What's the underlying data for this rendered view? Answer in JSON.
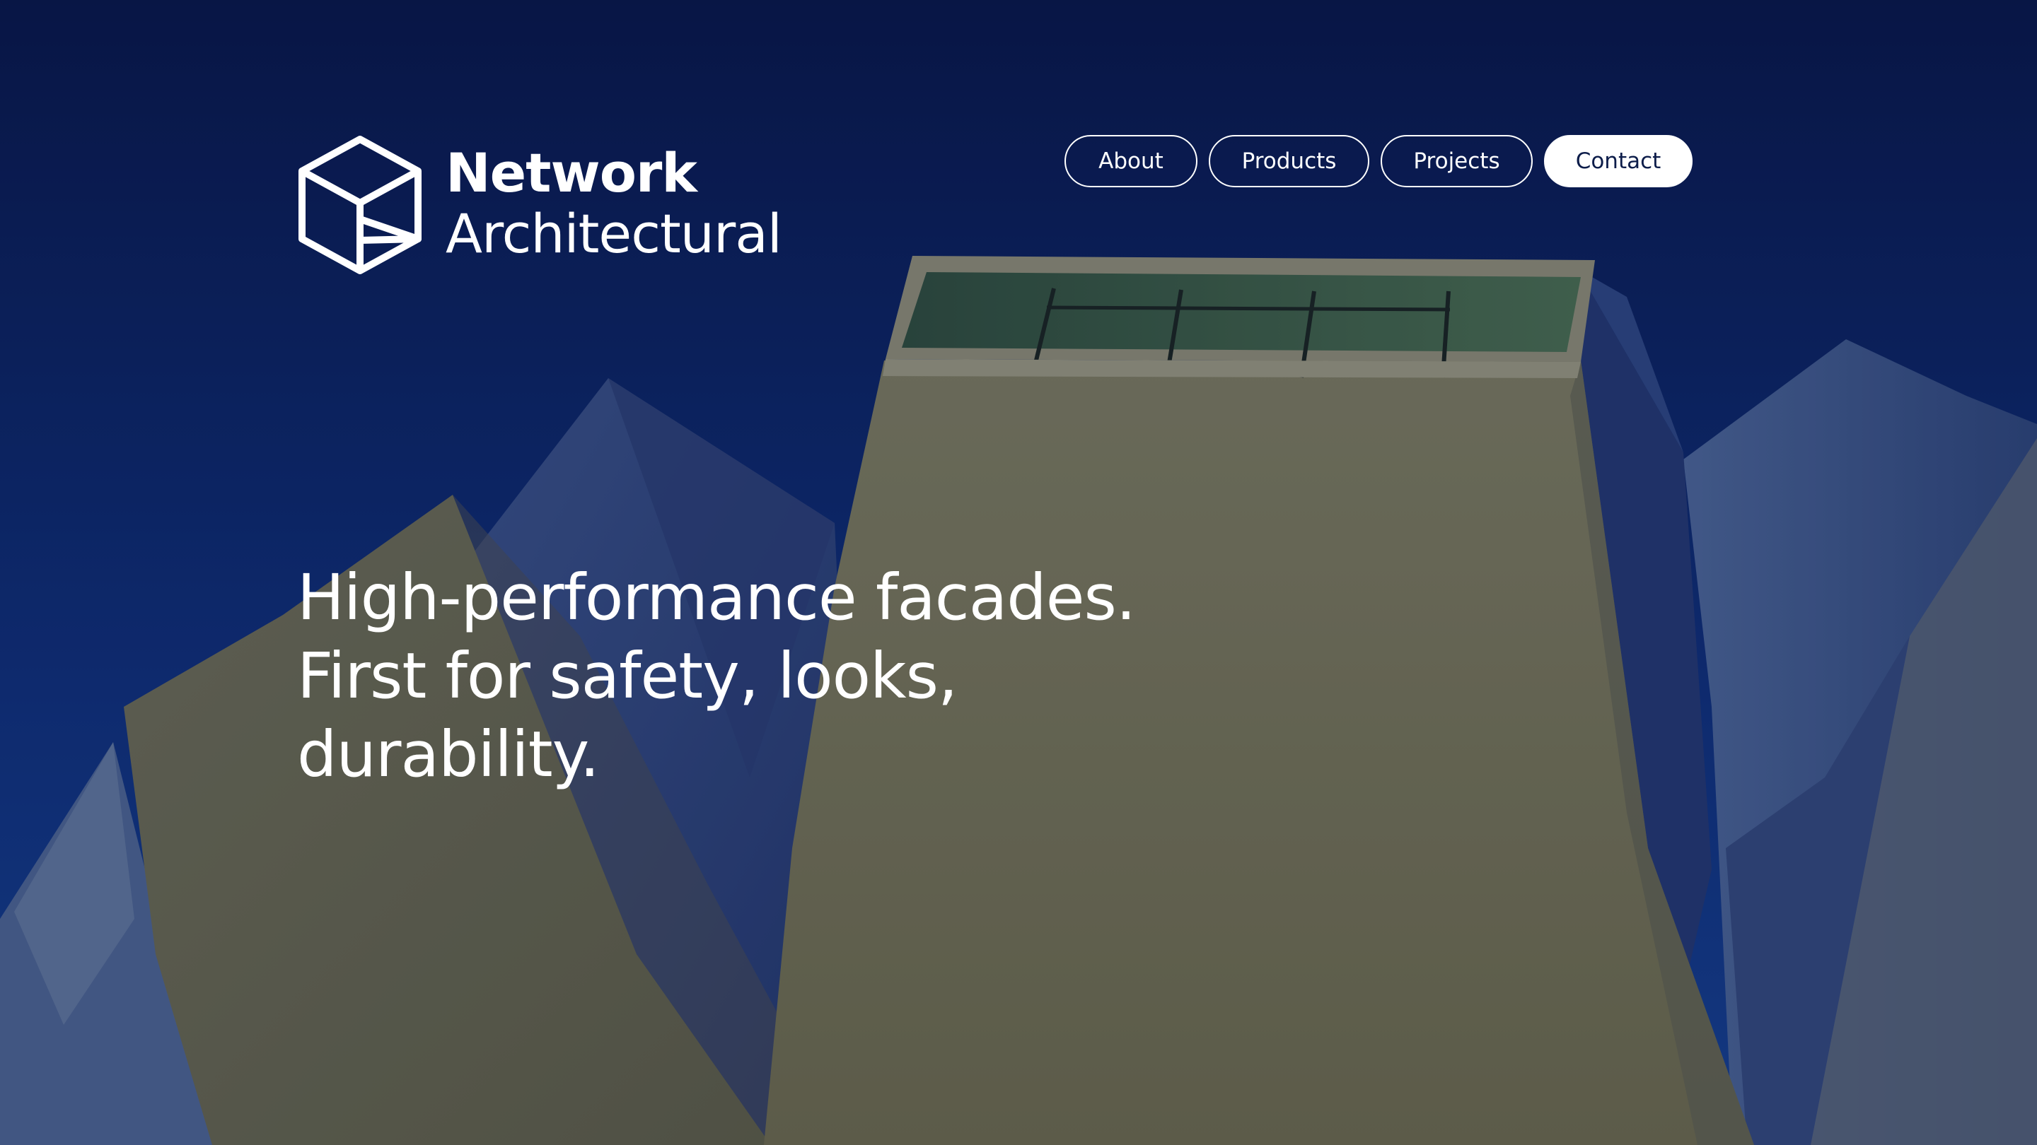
{
  "brand": {
    "name_line1": "Network",
    "name_line2": "Architectural",
    "logo_icon": "hexagon-cube-icon"
  },
  "nav": {
    "items": [
      {
        "label": "About",
        "active": false
      },
      {
        "label": "Products",
        "active": false
      },
      {
        "label": "Projects",
        "active": false
      },
      {
        "label": "Contact",
        "active": true
      }
    ]
  },
  "hero": {
    "headline_line1": "High-performance facades.",
    "headline_line2": "First for safety, looks,",
    "headline_line3": "durability."
  },
  "colors": {
    "sky_top": "#0a1a4f",
    "sky_bottom": "#153a8a",
    "building_cream": "#7c7a58",
    "text": "#ffffff",
    "contact_text": "#0d1d4a"
  }
}
